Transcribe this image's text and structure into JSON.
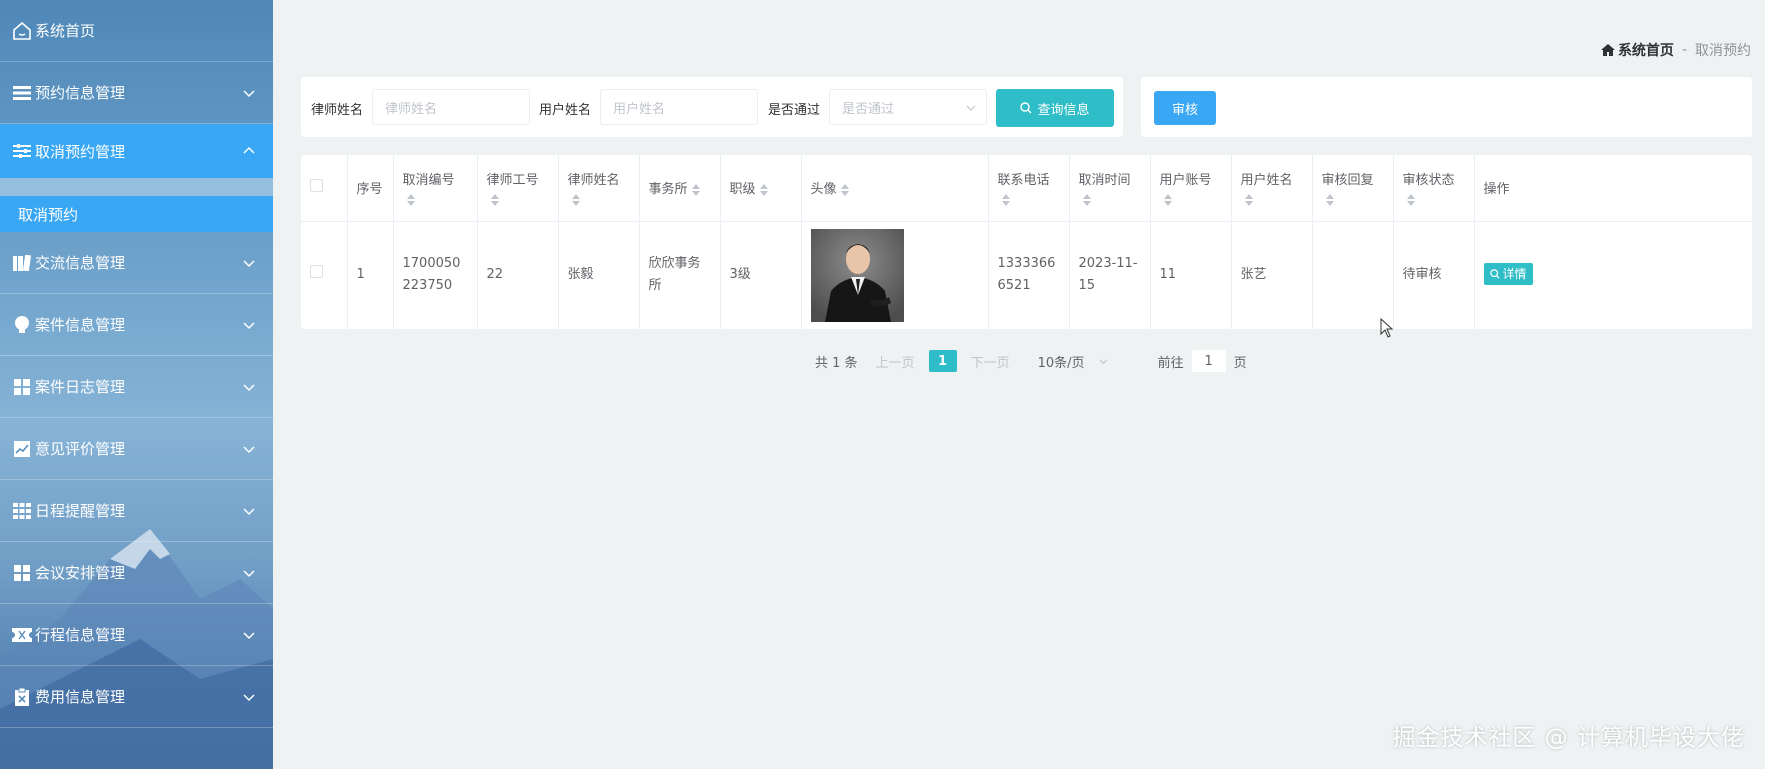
{
  "sidebar": {
    "home": "系统首页",
    "items": [
      {
        "label": "预约信息管理",
        "icon": "list-icon"
      },
      {
        "label": "取消预约管理",
        "icon": "sliders-icon",
        "expanded": true
      },
      {
        "label": "交流信息管理",
        "icon": "book-icon"
      },
      {
        "label": "案件信息管理",
        "icon": "bulb-icon"
      },
      {
        "label": "案件日志管理",
        "icon": "grid-icon"
      },
      {
        "label": "意见评价管理",
        "icon": "chart-icon"
      },
      {
        "label": "日程提醒管理",
        "icon": "calendar-grid-icon"
      },
      {
        "label": "会议安排管理",
        "icon": "grid-icon"
      },
      {
        "label": "行程信息管理",
        "icon": "ticket-icon"
      },
      {
        "label": "费用信息管理",
        "icon": "clipboard-icon"
      }
    ],
    "sub_item": "取消预约"
  },
  "breadcrumb": {
    "home": "系统首页",
    "separator": "-",
    "current": "取消预约"
  },
  "search": {
    "lawyer_name_label": "律师姓名",
    "lawyer_name_placeholder": "律师姓名",
    "user_name_label": "用户姓名",
    "user_name_placeholder": "用户姓名",
    "passed_label": "是否通过",
    "passed_placeholder": "是否通过",
    "query_button": "查询信息"
  },
  "actions": {
    "audit_button": "审核"
  },
  "table": {
    "headers": {
      "index": "序号",
      "cancel_no": "取消编号",
      "lawyer_id": "律师工号",
      "lawyer_name": "律师姓名",
      "firm": "事务所",
      "level": "职级",
      "avatar": "头像",
      "phone": "联系电话",
      "cancel_time": "取消时间",
      "user_account": "用户账号",
      "user_name": "用户姓名",
      "audit_reply": "审核回复",
      "audit_status": "审核状态",
      "operation": "操作"
    },
    "rows": [
      {
        "index": "1",
        "cancel_no": "1700050223750",
        "lawyer_id": "22",
        "lawyer_name": "张毅",
        "firm": "欣欣事务所",
        "level": "3级",
        "phone": "13333666521",
        "cancel_time": "2023-11-15",
        "user_account": "11",
        "user_name": "张艺",
        "audit_reply": "",
        "audit_status": "待审核",
        "detail_button": "详情"
      }
    ]
  },
  "pagination": {
    "total": "共 1 条",
    "prev": "上一页",
    "current_page": "1",
    "next": "下一页",
    "page_size": "10条/页",
    "goto_label": "前往",
    "goto_value": "1",
    "goto_suffix": "页"
  },
  "watermark": "掘金技术社区 @ 计算机毕设大佬",
  "colors": {
    "accent_teal": "#2fbdc7",
    "accent_blue": "#3aa7f4"
  }
}
